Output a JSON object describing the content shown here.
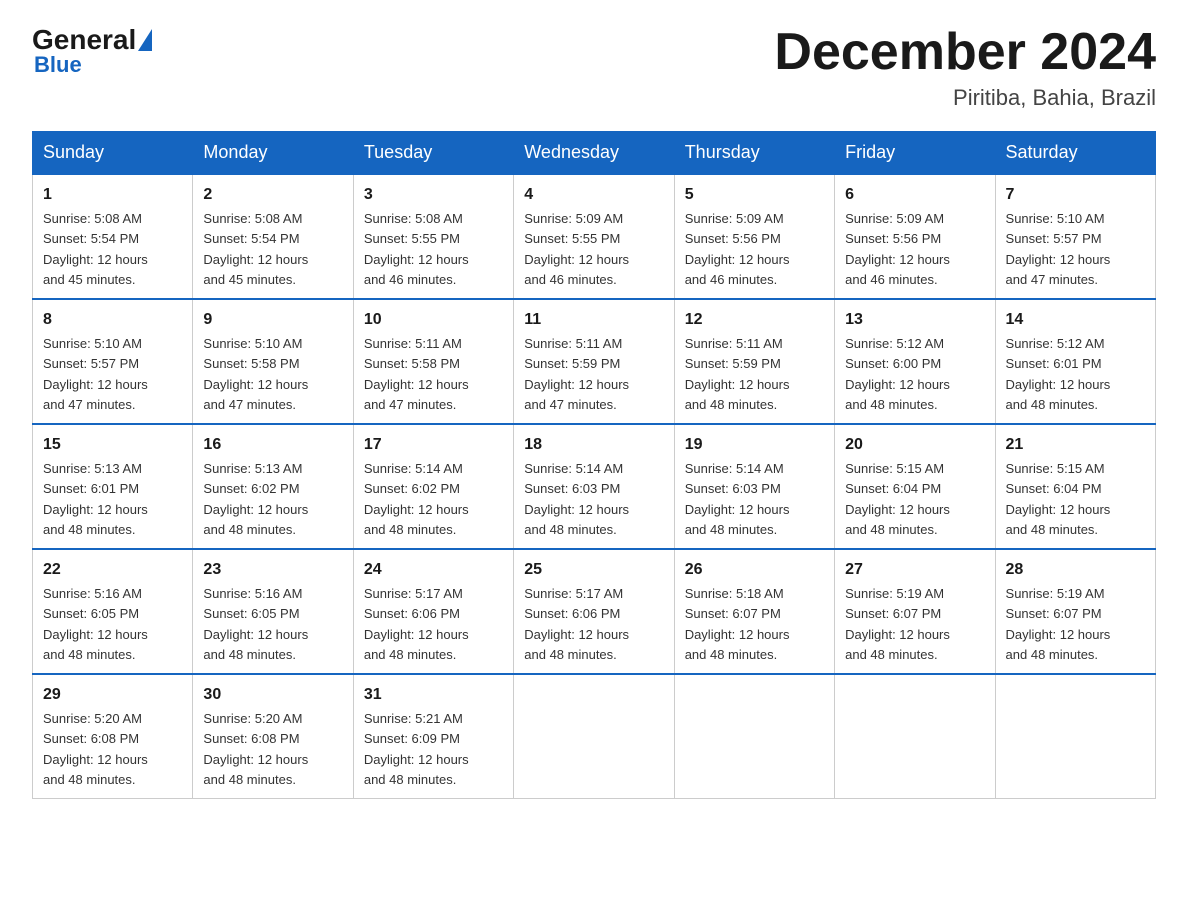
{
  "header": {
    "logo_general": "General",
    "logo_blue": "Blue",
    "month_title": "December 2024",
    "location": "Piritiba, Bahia, Brazil"
  },
  "days_of_week": [
    "Sunday",
    "Monday",
    "Tuesday",
    "Wednesday",
    "Thursday",
    "Friday",
    "Saturday"
  ],
  "weeks": [
    [
      {
        "day": "1",
        "sunrise": "5:08 AM",
        "sunset": "5:54 PM",
        "daylight": "12 hours and 45 minutes."
      },
      {
        "day": "2",
        "sunrise": "5:08 AM",
        "sunset": "5:54 PM",
        "daylight": "12 hours and 45 minutes."
      },
      {
        "day": "3",
        "sunrise": "5:08 AM",
        "sunset": "5:55 PM",
        "daylight": "12 hours and 46 minutes."
      },
      {
        "day": "4",
        "sunrise": "5:09 AM",
        "sunset": "5:55 PM",
        "daylight": "12 hours and 46 minutes."
      },
      {
        "day": "5",
        "sunrise": "5:09 AM",
        "sunset": "5:56 PM",
        "daylight": "12 hours and 46 minutes."
      },
      {
        "day": "6",
        "sunrise": "5:09 AM",
        "sunset": "5:56 PM",
        "daylight": "12 hours and 46 minutes."
      },
      {
        "day": "7",
        "sunrise": "5:10 AM",
        "sunset": "5:57 PM",
        "daylight": "12 hours and 47 minutes."
      }
    ],
    [
      {
        "day": "8",
        "sunrise": "5:10 AM",
        "sunset": "5:57 PM",
        "daylight": "12 hours and 47 minutes."
      },
      {
        "day": "9",
        "sunrise": "5:10 AM",
        "sunset": "5:58 PM",
        "daylight": "12 hours and 47 minutes."
      },
      {
        "day": "10",
        "sunrise": "5:11 AM",
        "sunset": "5:58 PM",
        "daylight": "12 hours and 47 minutes."
      },
      {
        "day": "11",
        "sunrise": "5:11 AM",
        "sunset": "5:59 PM",
        "daylight": "12 hours and 47 minutes."
      },
      {
        "day": "12",
        "sunrise": "5:11 AM",
        "sunset": "5:59 PM",
        "daylight": "12 hours and 48 minutes."
      },
      {
        "day": "13",
        "sunrise": "5:12 AM",
        "sunset": "6:00 PM",
        "daylight": "12 hours and 48 minutes."
      },
      {
        "day": "14",
        "sunrise": "5:12 AM",
        "sunset": "6:01 PM",
        "daylight": "12 hours and 48 minutes."
      }
    ],
    [
      {
        "day": "15",
        "sunrise": "5:13 AM",
        "sunset": "6:01 PM",
        "daylight": "12 hours and 48 minutes."
      },
      {
        "day": "16",
        "sunrise": "5:13 AM",
        "sunset": "6:02 PM",
        "daylight": "12 hours and 48 minutes."
      },
      {
        "day": "17",
        "sunrise": "5:14 AM",
        "sunset": "6:02 PM",
        "daylight": "12 hours and 48 minutes."
      },
      {
        "day": "18",
        "sunrise": "5:14 AM",
        "sunset": "6:03 PM",
        "daylight": "12 hours and 48 minutes."
      },
      {
        "day": "19",
        "sunrise": "5:14 AM",
        "sunset": "6:03 PM",
        "daylight": "12 hours and 48 minutes."
      },
      {
        "day": "20",
        "sunrise": "5:15 AM",
        "sunset": "6:04 PM",
        "daylight": "12 hours and 48 minutes."
      },
      {
        "day": "21",
        "sunrise": "5:15 AM",
        "sunset": "6:04 PM",
        "daylight": "12 hours and 48 minutes."
      }
    ],
    [
      {
        "day": "22",
        "sunrise": "5:16 AM",
        "sunset": "6:05 PM",
        "daylight": "12 hours and 48 minutes."
      },
      {
        "day": "23",
        "sunrise": "5:16 AM",
        "sunset": "6:05 PM",
        "daylight": "12 hours and 48 minutes."
      },
      {
        "day": "24",
        "sunrise": "5:17 AM",
        "sunset": "6:06 PM",
        "daylight": "12 hours and 48 minutes."
      },
      {
        "day": "25",
        "sunrise": "5:17 AM",
        "sunset": "6:06 PM",
        "daylight": "12 hours and 48 minutes."
      },
      {
        "day": "26",
        "sunrise": "5:18 AM",
        "sunset": "6:07 PM",
        "daylight": "12 hours and 48 minutes."
      },
      {
        "day": "27",
        "sunrise": "5:19 AM",
        "sunset": "6:07 PM",
        "daylight": "12 hours and 48 minutes."
      },
      {
        "day": "28",
        "sunrise": "5:19 AM",
        "sunset": "6:07 PM",
        "daylight": "12 hours and 48 minutes."
      }
    ],
    [
      {
        "day": "29",
        "sunrise": "5:20 AM",
        "sunset": "6:08 PM",
        "daylight": "12 hours and 48 minutes."
      },
      {
        "day": "30",
        "sunrise": "5:20 AM",
        "sunset": "6:08 PM",
        "daylight": "12 hours and 48 minutes."
      },
      {
        "day": "31",
        "sunrise": "5:21 AM",
        "sunset": "6:09 PM",
        "daylight": "12 hours and 48 minutes."
      },
      null,
      null,
      null,
      null
    ]
  ]
}
